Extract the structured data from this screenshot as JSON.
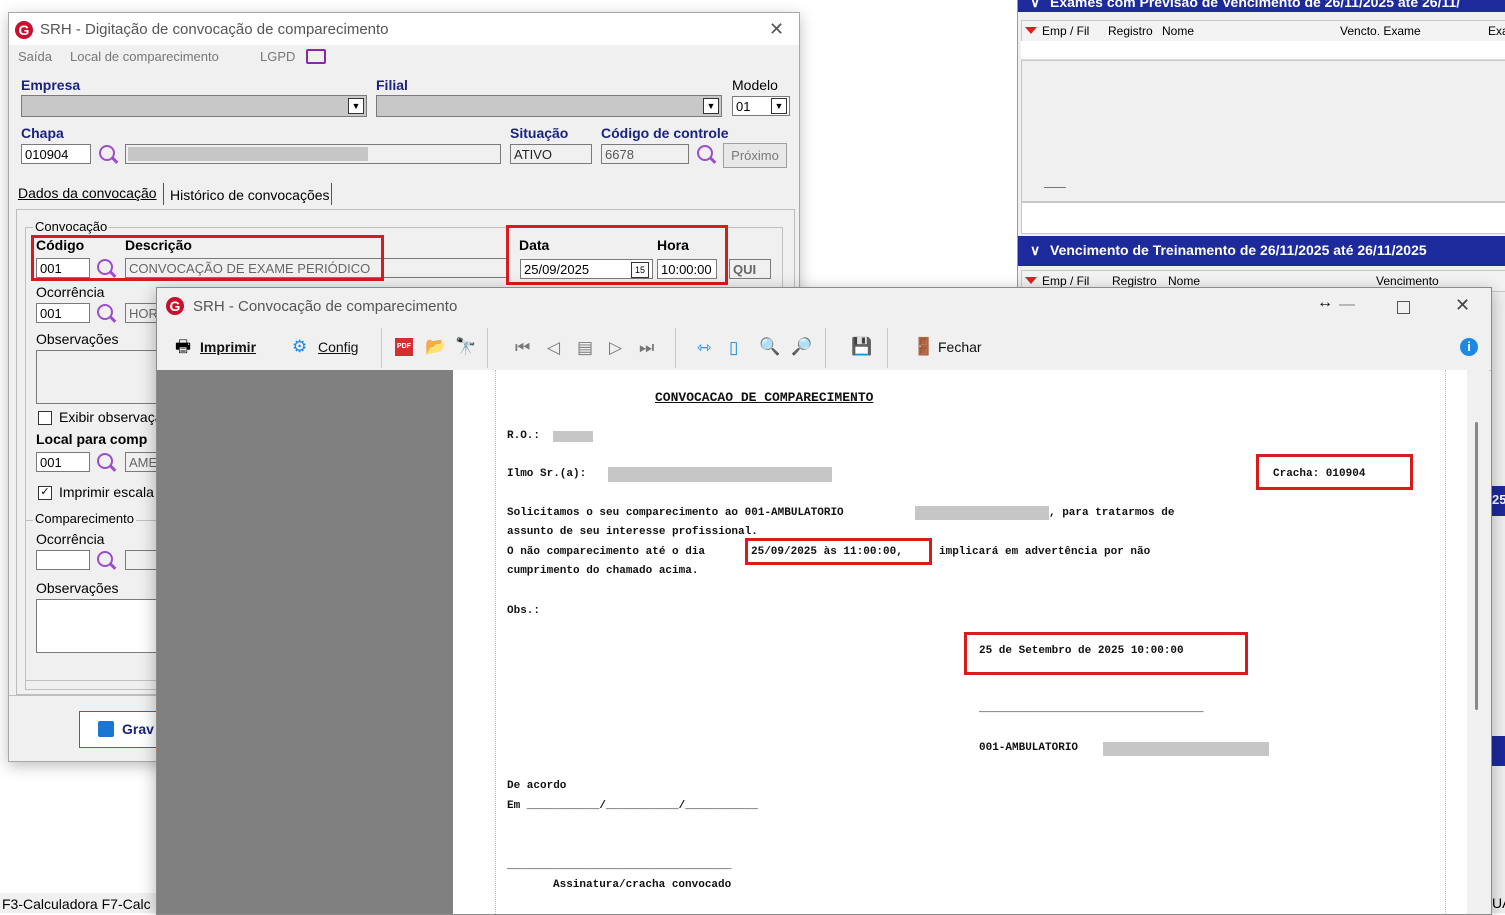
{
  "bg_window": {
    "exam_header": "Exames com Previsão de Vencimento de 26/11/2025 até 26/11/",
    "exam_columns": [
      "Emp / Fil",
      "Registro",
      "Nome",
      "Vencto. Exame",
      "Exa"
    ],
    "training_header": "Vencimento de Treinamento de 26/11/2025 até 26/11/2025",
    "training_columns": [
      "Emp / Fil",
      "Registro",
      "Nome",
      "Vencimento"
    ],
    "fragment_25": "25",
    "fragment_ua": "UA"
  },
  "statusbar": {
    "text": "F3-Calculadora F7-Calc"
  },
  "dialog1": {
    "title": "SRH - Digitação de convocação de comparecimento",
    "menu": [
      "Saída",
      "Local de comparecimento",
      "LGPD"
    ],
    "empresa_label": "Empresa",
    "filial_label": "Filial",
    "modelo_label": "Modelo",
    "modelo_value": "01",
    "chapa_label": "Chapa",
    "chapa_value": "010904",
    "situacao_label": "Situação",
    "situacao_value": "ATIVO",
    "codigo_controle_label": "Código de controle",
    "codigo_controle_value": "6678",
    "proximo_button": "Próximo",
    "tab_dados": "Dados da convocação",
    "tab_historico": "Histórico de convocações",
    "convocacao_group": "Convocação",
    "codigo_label": "Código",
    "descricao_label": "Descrição",
    "codigo_value": "001",
    "descricao_value": "CONVOCAÇÃO DE EXAME PERIÓDICO",
    "data_label": "Data",
    "hora_label": "Hora",
    "data_value": "25/09/2025",
    "cal_glyph": "15",
    "hora_value": "10:00:00",
    "qui_value": "QUI",
    "ocorrencia_label": "Ocorrência",
    "ocorrencia_value": "001",
    "ocorrencia_desc": "HOR",
    "observacoes_label": "Observações",
    "exibir_obs_label": "Exibir observaçã",
    "local_label": "Local para comp",
    "local_value": "001",
    "local_desc": "AME",
    "imprimir_escala_label": "Imprimir escala d",
    "comparecimento_group": "Comparecimento",
    "comp_ocorrencia_label": "Ocorrência",
    "comp_observacoes_label": "Observações",
    "gravar_button": "Grav"
  },
  "viewer": {
    "title": "SRH - Convocação de comparecimento",
    "imprimir": "Imprimir",
    "config": "Config",
    "fechar": "Fechar",
    "pdf": "PDF",
    "report": {
      "heading": "CONVOCACAO DE COMPARECIMENTO",
      "ro_label": "R.O.:",
      "ilmo_label": "Ilmo Sr.(a):",
      "cracha": "Cracha: 010904",
      "line1_a": "Solicitamos o seu comparecimento ao 001-AMBULATORIO",
      "line1_b": ", para tratarmos de",
      "line2": "assunto de seu interesse profissional.",
      "line3_a": "O não comparecimento até o dia",
      "line3_date": "25/09/2025 às 11:00:00,",
      "line3_b": "implicará em advertência por não",
      "line4": "cumprimento do chamado acima.",
      "obs": "Obs.:",
      "date_full": "25 de Setembro de 2025 10:00:00",
      "sig_line": "__________________________________",
      "ambulatorio": "001-AMBULATORIO",
      "de_acordo": "De acordo",
      "em_line": "Em ___________/___________/___________",
      "sig_line2": "__________________________________",
      "assinatura": "Assinatura/cracha convocado"
    }
  }
}
